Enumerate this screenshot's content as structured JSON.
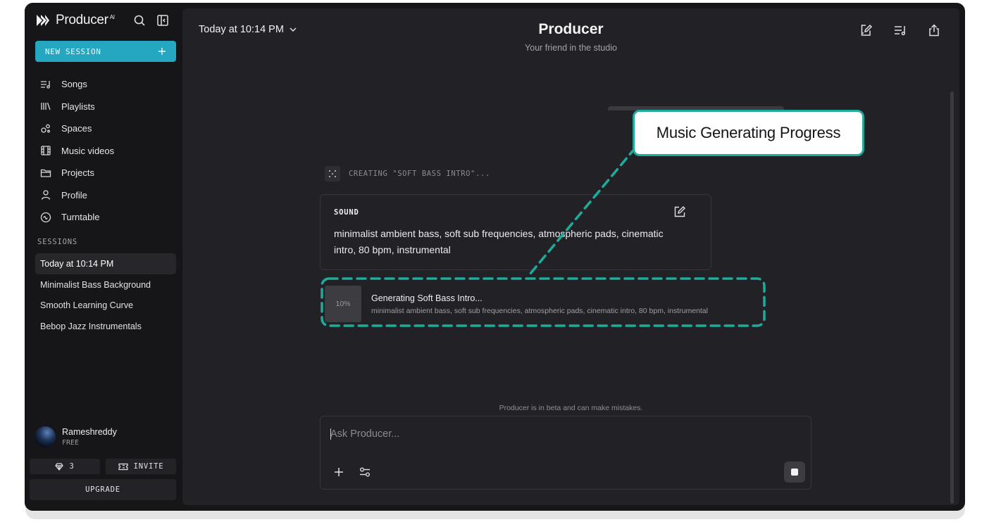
{
  "sidebar": {
    "brand": "Producer",
    "brand_ai": "AI",
    "new_session": "NEW SESSION",
    "items": [
      {
        "label": "Songs",
        "icon": "songs-icon"
      },
      {
        "label": "Playlists",
        "icon": "playlists-icon"
      },
      {
        "label": "Spaces",
        "icon": "spaces-icon"
      },
      {
        "label": "Music videos",
        "icon": "film-icon"
      },
      {
        "label": "Projects",
        "icon": "folder-icon"
      },
      {
        "label": "Profile",
        "icon": "user-icon"
      },
      {
        "label": "Turntable",
        "icon": "turntable-icon"
      }
    ],
    "sessions_label": "SESSIONS",
    "sessions": [
      {
        "label": "Today at 10:14 PM",
        "active": true
      },
      {
        "label": "Minimalist Bass Background"
      },
      {
        "label": "Smooth Learning Curve"
      },
      {
        "label": "Bebop Jazz Instrumentals"
      }
    ],
    "user": {
      "name": "Rameshreddy",
      "plan": "FREE"
    },
    "credits": "3",
    "invite": "INVITE",
    "upgrade": "UPGRADE"
  },
  "header": {
    "session_date": "Today at 10:14 PM",
    "title": "Producer",
    "subtitle": "Your friend in the studio"
  },
  "chat": {
    "creating_text": "CREATING \"SOFT BASS INTRO\"...",
    "sound": {
      "label": "SOUND",
      "text": "minimalist ambient bass, soft sub frequencies, atmospheric pads, cinematic intro, 80 bpm, instrumental"
    },
    "track": {
      "progress": "10%",
      "progress_value": 0.1,
      "title": "Generating Soft Bass Intro...",
      "description": "minimalist ambient bass, soft sub frequencies, atmospheric pads, cinematic intro, 80 bpm, instrumental"
    }
  },
  "composer": {
    "beta_notice": "Producer is in beta and can make mistakes.",
    "placeholder": "Ask Producer..."
  },
  "annotation": {
    "label": "Music Generating Progress",
    "color": "#1fab9b"
  },
  "colors": {
    "accent": "#25a6c1",
    "background": "#161619",
    "panel": "#222226"
  }
}
